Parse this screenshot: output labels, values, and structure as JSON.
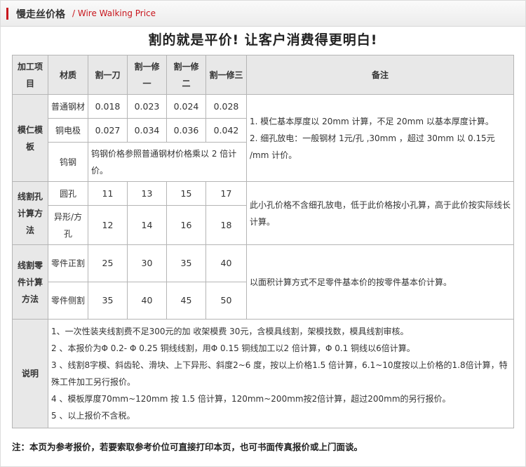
{
  "header": {
    "title_cn": "慢走丝价格",
    "title_en": "/ Wire Walking Price"
  },
  "headline": "割的就是平价! 让客户消费得更明白!",
  "table": {
    "headers": {
      "item": "加工项目",
      "material": "材质",
      "cut1": "割一刀",
      "cut1trim1": "割一修一",
      "cut1trim2": "割一修二",
      "cut1trim3": "割一修三",
      "remark": "备注"
    },
    "mold_core": {
      "label": "模仁模板",
      "rows": [
        {
          "material": "普通钢材",
          "v1": "0.018",
          "v2": "0.023",
          "v3": "0.024",
          "v4": "0.028"
        },
        {
          "material": "铜电极",
          "v1": "0.027",
          "v2": "0.034",
          "v3": "0.036",
          "v4": "0.042"
        }
      ],
      "tungsten_material": "钨钢",
      "tungsten_note": "钨钢价格参照普通钢材价格乘以 2 倍计价。",
      "note1": "1. 模仁基本厚度以 20mm 计算，不足 20mm 以基本厚度计算。",
      "note2": "2. 细孔放电：一般钢材 1元/孔 ,30mm ，超过 30mm 以 0.15元 /mm 计价。"
    },
    "hole": {
      "label": "线割孔计算方法",
      "rows": [
        {
          "material": "圆孔",
          "v1": "11",
          "v2": "13",
          "v3": "15",
          "v4": "17"
        },
        {
          "material": "异形/方孔",
          "v1": "12",
          "v2": "14",
          "v3": "16",
          "v4": "18"
        }
      ],
      "note": "此小孔价格不含细孔放电，低于此价格按小孔算，高于此价按实际线长计算。"
    },
    "part": {
      "label": "线割零件计算方法",
      "rows": [
        {
          "material": "零件正割",
          "v1": "25",
          "v2": "30",
          "v3": "35",
          "v4": "40"
        },
        {
          "material": "零件侧割",
          "v1": "35",
          "v2": "40",
          "v3": "45",
          "v4": "50"
        }
      ],
      "note": "以面积计算方式不足零件基本价的按零件基本价计算。"
    },
    "explain": {
      "label": "说明",
      "items": [
        "1、一次性装夹线割费不足300元的加 收架模费 30元，含模具线割，架模找数，模具线割审核。",
        "2 、本报价为Φ 0.2- Φ 0.25 铜线线割，用Φ 0.15 铜线加工以2 倍计算，Φ 0.1 铜线以6倍计算。",
        "3 、线割8字模、斜齿轮、滑块、上下异形、斜度2~6 度，按以上价格1.5 倍计算，6.1~10度按以上价格的1.8倍计算，特殊工件加工另行报价。",
        "4 、模板厚度70mm~120mm 按 1.5 倍计算，120mm~200mm按2倍计算，超过200mm的另行报价。",
        "5 、以上报价不含税。"
      ]
    }
  },
  "footer": "注：本页为参考报价，若要索取参考价位可直接打印本页，也可书面传真报价或上门面谈。"
}
